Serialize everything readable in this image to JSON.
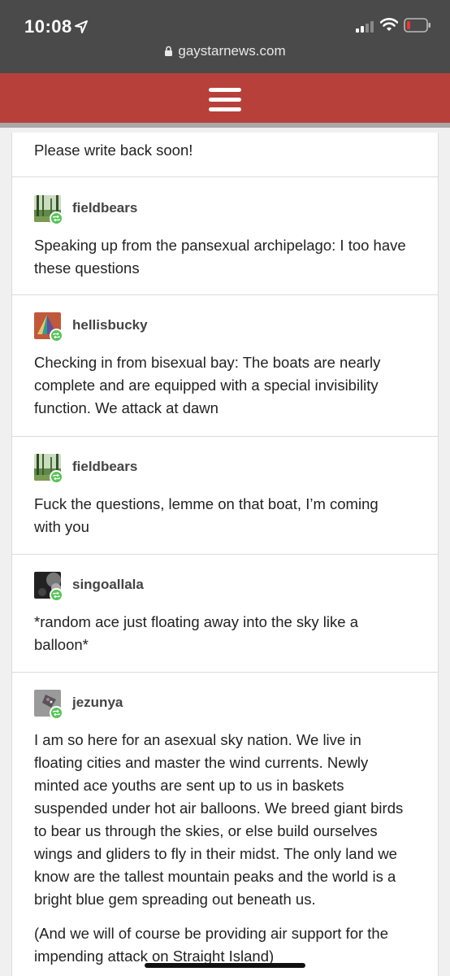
{
  "status_bar": {
    "time": "10:08",
    "url": "gaystarnews.com",
    "icons": [
      "location-arrow-icon",
      "signal-icon",
      "wifi-icon",
      "battery-low-icon",
      "lock-icon"
    ]
  },
  "nav": {
    "menu_icon": "hamburger-menu-icon",
    "color": "#b8403a"
  },
  "thread": {
    "top_fragment": "Please write back soon!",
    "posts": [
      {
        "username": "fieldbears",
        "avatar": "forest-avatar",
        "text": [
          "Speaking up from the pansexual archipelago: I too have",
          "these questions"
        ]
      },
      {
        "username": "hellisbucky",
        "avatar": "triangle-art-avatar",
        "text": [
          "Checking in from bisexual bay: The boats are nearly",
          "complete and are equipped with a special invisibility",
          "function. We attack at dawn"
        ]
      },
      {
        "username": "fieldbears",
        "avatar": "forest-avatar",
        "text": [
          "Fuck the questions, lemme on that boat, I’m coming",
          "with you"
        ]
      },
      {
        "username": "singoallala",
        "avatar": "dark-texture-avatar",
        "text": [
          "*random ace just floating away into the sky like a",
          "balloon*"
        ]
      },
      {
        "username": "jezunya",
        "avatar": "gray-pattern-avatar",
        "text": [
          "I am so here for an asexual sky nation. We live in",
          "floating cities and master the wind currents. Newly",
          "minted ace youths are sent up to us in baskets",
          "suspended under hot air balloons. We breed giant birds",
          "to bear us through the skies, or else build ourselves",
          "wings and gliders to fly in their midst. The only land we",
          "know are the tallest mountain peaks and the world is a",
          "bright blue gem spreading out beneath us."
        ]
      }
    ],
    "last_paragraph": [
      "(And we will of course be providing air support for the",
      "impending attack on Straight Island)"
    ]
  },
  "colors": {
    "reblog_badge": "#56c456",
    "status_bar": "#4a4a4a"
  }
}
